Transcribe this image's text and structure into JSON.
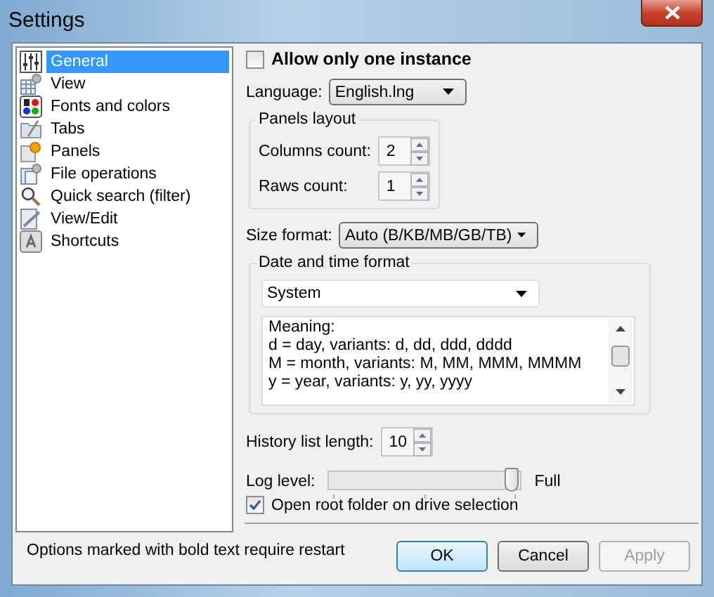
{
  "window": {
    "title": "Settings"
  },
  "sidebar": {
    "items": [
      {
        "label": "General",
        "selected": true
      },
      {
        "label": "View",
        "selected": false
      },
      {
        "label": "Fonts and colors",
        "selected": false
      },
      {
        "label": "Tabs",
        "selected": false
      },
      {
        "label": "Panels",
        "selected": false
      },
      {
        "label": "File operations",
        "selected": false
      },
      {
        "label": "Quick search (filter)",
        "selected": false
      },
      {
        "label": "View/Edit",
        "selected": false
      },
      {
        "label": "Shortcuts",
        "selected": false
      }
    ]
  },
  "allow_one_instance": {
    "label": "Allow only one instance",
    "checked": false
  },
  "language": {
    "label": "Language:",
    "value": "English.lng"
  },
  "panels_layout": {
    "title": "Panels layout",
    "fields": [
      {
        "label": "Columns count:",
        "value": "2"
      },
      {
        "label": "Raws count:",
        "value": "1"
      }
    ]
  },
  "size_format": {
    "label": "Size format:",
    "value": "Auto (B/KB/MB/GB/TB)"
  },
  "date_time": {
    "title": "Date and time format",
    "value": "System",
    "help_lines": [
      "Meaning:",
      "d = day, variants: d, dd, ddd, dddd",
      "M = month, variants: M, MM, MMM, MMMM",
      "y = year, variants: y, yy, yyyy"
    ]
  },
  "history": {
    "label": "History list length:",
    "value": "10"
  },
  "log_level": {
    "label": "Log level:",
    "level": 1,
    "reading": "Full"
  },
  "open_root": {
    "label": "Open root folder on drive selection",
    "checked": true
  },
  "footer_note": "Options marked with bold text require restart",
  "buttons": [
    {
      "label": "OK",
      "default": true,
      "disabled": false
    },
    {
      "label": "Cancel",
      "default": false,
      "disabled": false
    },
    {
      "label": "Apply",
      "default": false,
      "disabled": true
    }
  ]
}
